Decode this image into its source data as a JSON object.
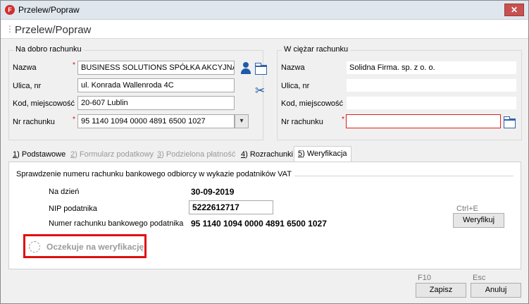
{
  "window": {
    "title": "Przelew/Popraw",
    "close_symbol": "✕"
  },
  "header": {
    "title": "Przelew/Popraw"
  },
  "left_group": {
    "legend": "Na dobro rachunku",
    "labels": {
      "nazwa": "Nazwa",
      "ulica": "Ulica, nr",
      "kod": "Kod, miejscowość",
      "nr": "Nr rachunku"
    },
    "values": {
      "nazwa": "BUSINESS SOLUTIONS SPÓŁKA AKCYJNA",
      "ulica": "ul. Konrada Wallenroda 4C",
      "kod": "20-607 Lublin",
      "nr": "95 1140 1094 0000 4891 6500 1027"
    }
  },
  "right_group": {
    "legend": "W ciężar rachunku",
    "labels": {
      "nazwa": "Nazwa",
      "ulica": "Ulica, nr",
      "kod": "Kod, miejscowość",
      "nr": "Nr rachunku"
    },
    "values": {
      "nazwa": "Solidna Firma. sp. z o. o.",
      "ulica": "",
      "kod": "",
      "nr": ""
    }
  },
  "required_mark": "*",
  "tabs": [
    {
      "num": "1",
      "label": "Podstawowe"
    },
    {
      "num": "2",
      "label": "Formularz podatkowy"
    },
    {
      "num": "3",
      "label": "Podzielona płatność"
    },
    {
      "num": "4",
      "label": "Rozrachunki"
    },
    {
      "num": "5",
      "label": "Weryfikacja"
    }
  ],
  "verification": {
    "section_title": "Sprawdzenie numeru rachunku bankowego odbiorcy w wykazie podatników VAT",
    "date_label": "Na dzień",
    "date_value": "30-09-2019",
    "nip_label": "NIP podatnika",
    "nip_value": "5222612717",
    "account_label": "Numer rachunku bankowego podatnika",
    "account_value": "95 1140 1094 0000 4891 6500 1027",
    "shortcut": "Ctrl+E",
    "verify_button": "Weryfikuj",
    "status": "Oczekuje na weryfikację"
  },
  "footer": {
    "save_shortcut": "F10",
    "save_button": "Zapisz",
    "cancel_shortcut": "Esc",
    "cancel_button": "Anuluj"
  },
  "colors": {
    "accent_icon": "#1f5aa8",
    "error_border": "#e02020",
    "highlight": "#e01010"
  }
}
